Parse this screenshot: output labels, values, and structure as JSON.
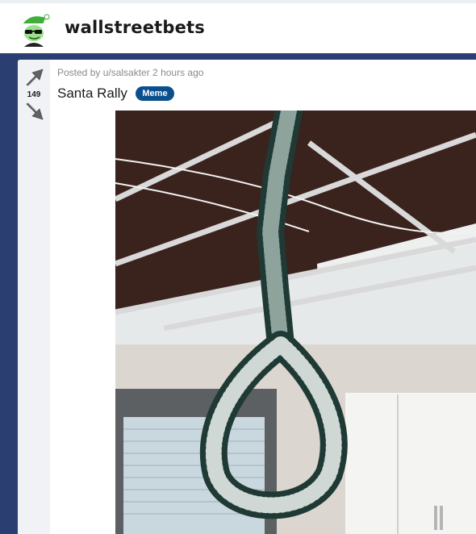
{
  "header": {
    "subreddit": "wallstreetbets",
    "icon": "wsb-elf-mascot-icon"
  },
  "post": {
    "vote_count": "149",
    "meta": "Posted by u/salsakter 2 hours ago",
    "title": "Santa Rally",
    "flair": "Meme",
    "image_description": "tinsel-noose-hanging-from-office-ceiling"
  },
  "colors": {
    "page_background": "#2a3e72",
    "flair_background": "#0b4f8e",
    "vote_column": "#f0f2f6",
    "mascot_green": "#3fae3a"
  }
}
